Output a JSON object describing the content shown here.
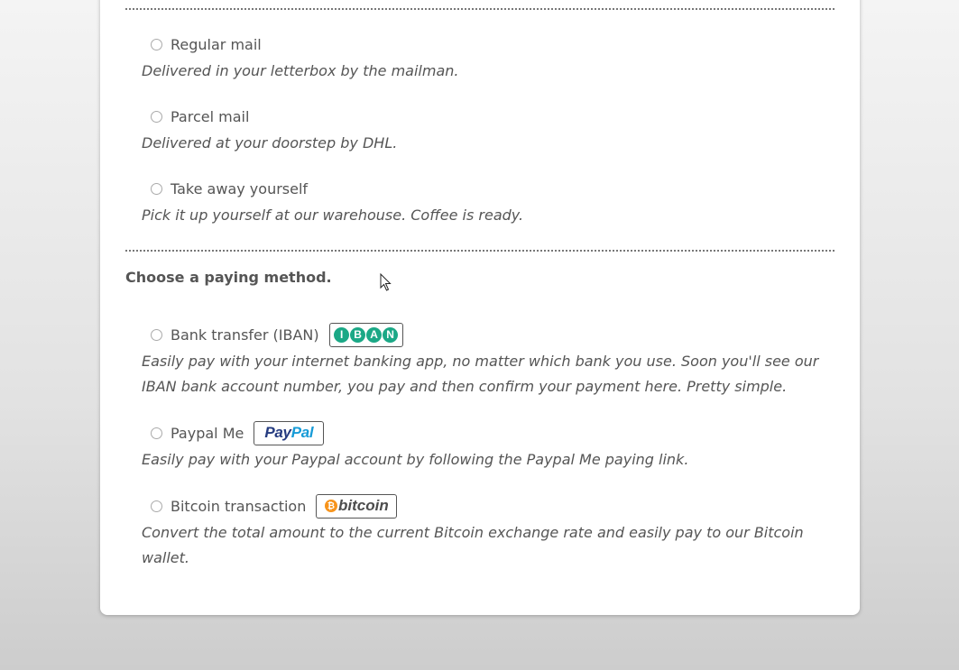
{
  "delivery": {
    "options": [
      {
        "label": "Regular mail",
        "description": "Delivered in your letterbox by the mailman."
      },
      {
        "label": "Parcel mail",
        "description": "Delivered at your doorstep by DHL."
      },
      {
        "label": "Take away yourself",
        "description": "Pick it up yourself at our warehouse. Coffee is ready."
      }
    ]
  },
  "payment": {
    "title": "Choose a paying method.",
    "options": [
      {
        "label": "Bank transfer (IBAN)",
        "badge_letters": [
          "I",
          "B",
          "A",
          "N"
        ],
        "description": "Easily pay with your internet banking app, no matter which bank you use. Soon you'll see our IBAN bank account number, you pay and then confirm your payment here. Pretty simple."
      },
      {
        "label": "Paypal Me",
        "badge_text_a": "Pay",
        "badge_text_b": "Pal",
        "description": "Easily pay with your Paypal account by following the Paypal Me paying link."
      },
      {
        "label": "Bitcoin transaction",
        "badge_symbol": "₿",
        "badge_text": "bitcoin",
        "description": "Convert the total amount to the current Bitcoin exchange rate and easily pay to our Bitcoin wallet."
      }
    ]
  },
  "colors": {
    "iban_green": "#1ba886",
    "paypal_dark": "#253b80",
    "paypal_light": "#179bd7",
    "bitcoin_orange": "#f7931a"
  },
  "icons": [
    "radio-unchecked-icon",
    "iban-logo",
    "paypal-logo",
    "bitcoin-logo",
    "mouse-cursor-icon"
  ]
}
